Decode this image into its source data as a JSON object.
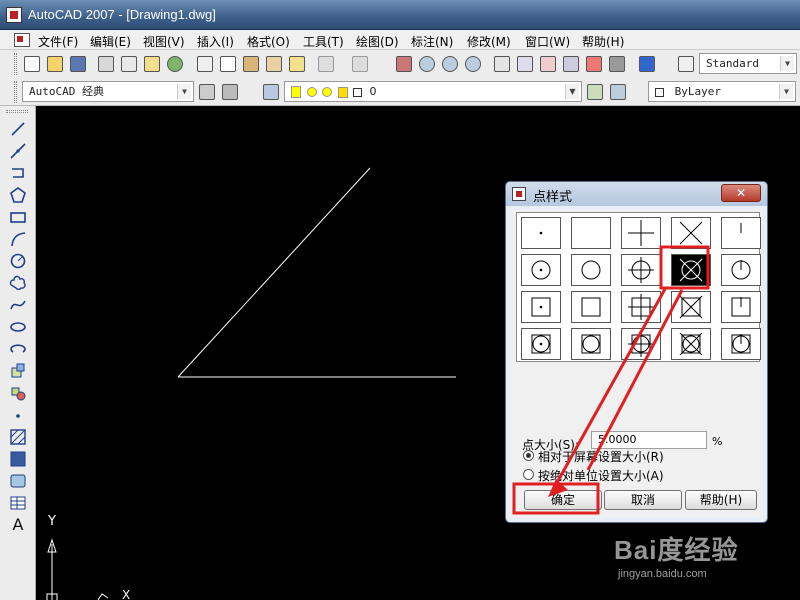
{
  "window": {
    "title": "AutoCAD 2007 - [Drawing1.dwg]"
  },
  "menubar": {
    "items": [
      "文件(F)",
      "编辑(E)",
      "视图(V)",
      "插入(I)",
      "格式(O)",
      "工具(T)",
      "绘图(D)",
      "标注(N)",
      "修改(M)",
      "窗口(W)",
      "帮助(H)"
    ]
  },
  "toolbar": {
    "text_style": "Standard",
    "workspace": "AutoCAD 经典",
    "layer": "0",
    "linetype": "ByLayer"
  },
  "palette": {
    "tools": [
      "line-icon",
      "construction-line-icon",
      "polyline-icon",
      "polygon-icon",
      "rectangle-icon",
      "arc-icon",
      "circle-icon",
      "revision-cloud-icon",
      "spline-icon",
      "ellipse-icon",
      "ellipse-arc-icon",
      "insert-block-icon",
      "make-block-icon",
      "point-icon",
      "hatch-icon",
      "gradient-icon",
      "region-icon",
      "table-icon",
      "multiline-text-icon"
    ],
    "text_tool": "A"
  },
  "canvas": {
    "ucs_y": "Y",
    "ucs_x": "X"
  },
  "dialog": {
    "title": "点样式",
    "close": "✕",
    "point_styles": [
      "dot",
      "none",
      "plus",
      "x",
      "tick",
      "circle-dot",
      "circle",
      "circle-plus",
      "circle-x",
      "circle-tick",
      "square-dot",
      "square",
      "square-plus",
      "square-x",
      "square-tick",
      "square-circle-dot",
      "square-circle",
      "square-circle-plus",
      "square-circle-x",
      "square-circle-tick"
    ],
    "selected_index": 8,
    "size_label": "点大小(S):",
    "size_value": "5.0000",
    "percent": "%",
    "radio_relative": "相对于屏幕设置大小(R)",
    "radio_absolute": "按绝对单位设置大小(A)",
    "relative_checked": true,
    "ok_label": "确定",
    "cancel_label": "取消",
    "help_label": "帮助(H)"
  },
  "annotations": {
    "color": "#e02020"
  },
  "watermark": {
    "logo": "Bai度经验",
    "url": "jingyan.baidu.com"
  }
}
